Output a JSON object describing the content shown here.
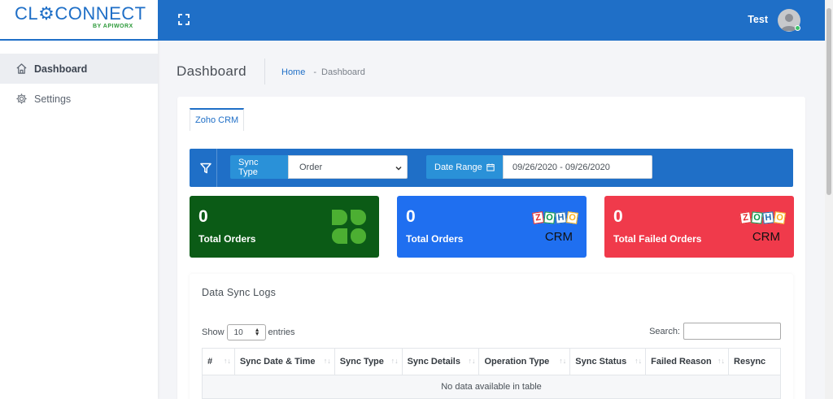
{
  "app": {
    "logo_main": "CL⚙CONNECT",
    "logo_sub": "BY APIWORX"
  },
  "sidebar": {
    "items": [
      {
        "label": "Dashboard",
        "icon": "home-icon",
        "active": true
      },
      {
        "label": "Settings",
        "icon": "gear-icon",
        "active": false
      }
    ]
  },
  "topbar": {
    "user_name": "Test",
    "expand_icon": "fullscreen-icon",
    "avatar_icon": "user-avatar-icon"
  },
  "header": {
    "title": "Dashboard",
    "breadcrumb": {
      "home": "Home",
      "separator": "-",
      "current": "Dashboard"
    }
  },
  "tabs": [
    {
      "label": "Zoho CRM",
      "active": true
    }
  ],
  "filters": {
    "filter_icon": "filter-icon",
    "sync_type_label": "Sync Type",
    "sync_type_value": "Order",
    "date_range_label": "Date Range",
    "date_range_icon": "calendar-icon",
    "date_range_value": "09/26/2020 - 09/26/2020"
  },
  "stats": [
    {
      "value": "0",
      "label": "Total Orders",
      "brand": "clover",
      "color": "#0b5b16"
    },
    {
      "value": "0",
      "label": "Total Orders",
      "brand": "zoho-crm",
      "brand_text": "CRM",
      "color": "#1f6ff0"
    },
    {
      "value": "0",
      "label": "Total Failed Orders",
      "brand": "zoho-crm",
      "brand_text": "CRM",
      "color": "#f03a4b"
    }
  ],
  "zoho_letters": [
    "Z",
    "O",
    "H",
    "O"
  ],
  "logs": {
    "title": "Data Sync Logs",
    "show_label": "Show",
    "entries_value": "10",
    "entries_label": "entries",
    "search_label": "Search:",
    "columns": [
      "#",
      "Sync Date & Time",
      "Sync Type",
      "Sync Details",
      "Operation Type",
      "Sync Status",
      "Failed Reason",
      "Resync"
    ],
    "empty_message": "No data available in table"
  },
  "colors": {
    "primary": "#1f6fc7",
    "addon": "#2a91d8",
    "clover_green": "#0b5b16",
    "zoho_blue": "#1f6ff0",
    "failed_red": "#f03a4b"
  }
}
